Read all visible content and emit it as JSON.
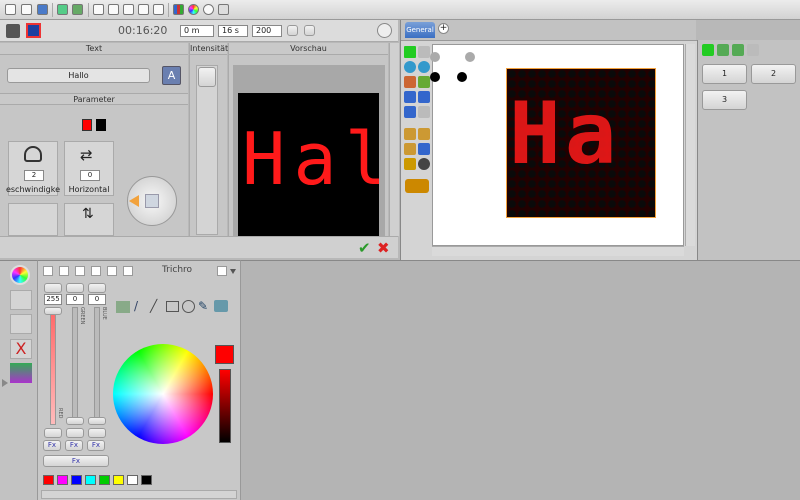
{
  "toolbar": {
    "time": "00:16:20",
    "pos_field": "0 m",
    "dur_field": "16 s",
    "count_field": "200"
  },
  "text_panel": {
    "title": "Text",
    "value": "Hallo",
    "params_title": "Parameter",
    "knob1_label": "eschwindigke",
    "knob1_value": "2",
    "knob2_label": "Horizontal",
    "knob2_value": "0",
    "intensity_title": "Intensität",
    "preview_title": "Vorschau",
    "preview_text": "Hal"
  },
  "stage": {
    "tab_label": "General",
    "add_tab": "+",
    "matrix_text": "Ha"
  },
  "right_panel": {
    "buttons": [
      "1",
      "2",
      "3"
    ]
  },
  "color_editor": {
    "title": "Trichro",
    "red_value": "255",
    "green_value": "0",
    "blue_value": "0",
    "red_label": "RED",
    "green_label": "GREEN",
    "blue_label": "BLUE",
    "fx_labels": [
      "Fx",
      "Fx",
      "Fx"
    ],
    "fx_all": "Fx",
    "current_color": "#ff0000"
  },
  "palette": [
    "#ff0000",
    "#ff00ff",
    "#0000ff",
    "#00ffff",
    "#00cc00",
    "#ffff00",
    "#ffffff",
    "#000000"
  ],
  "accent": "#1a6ae0"
}
